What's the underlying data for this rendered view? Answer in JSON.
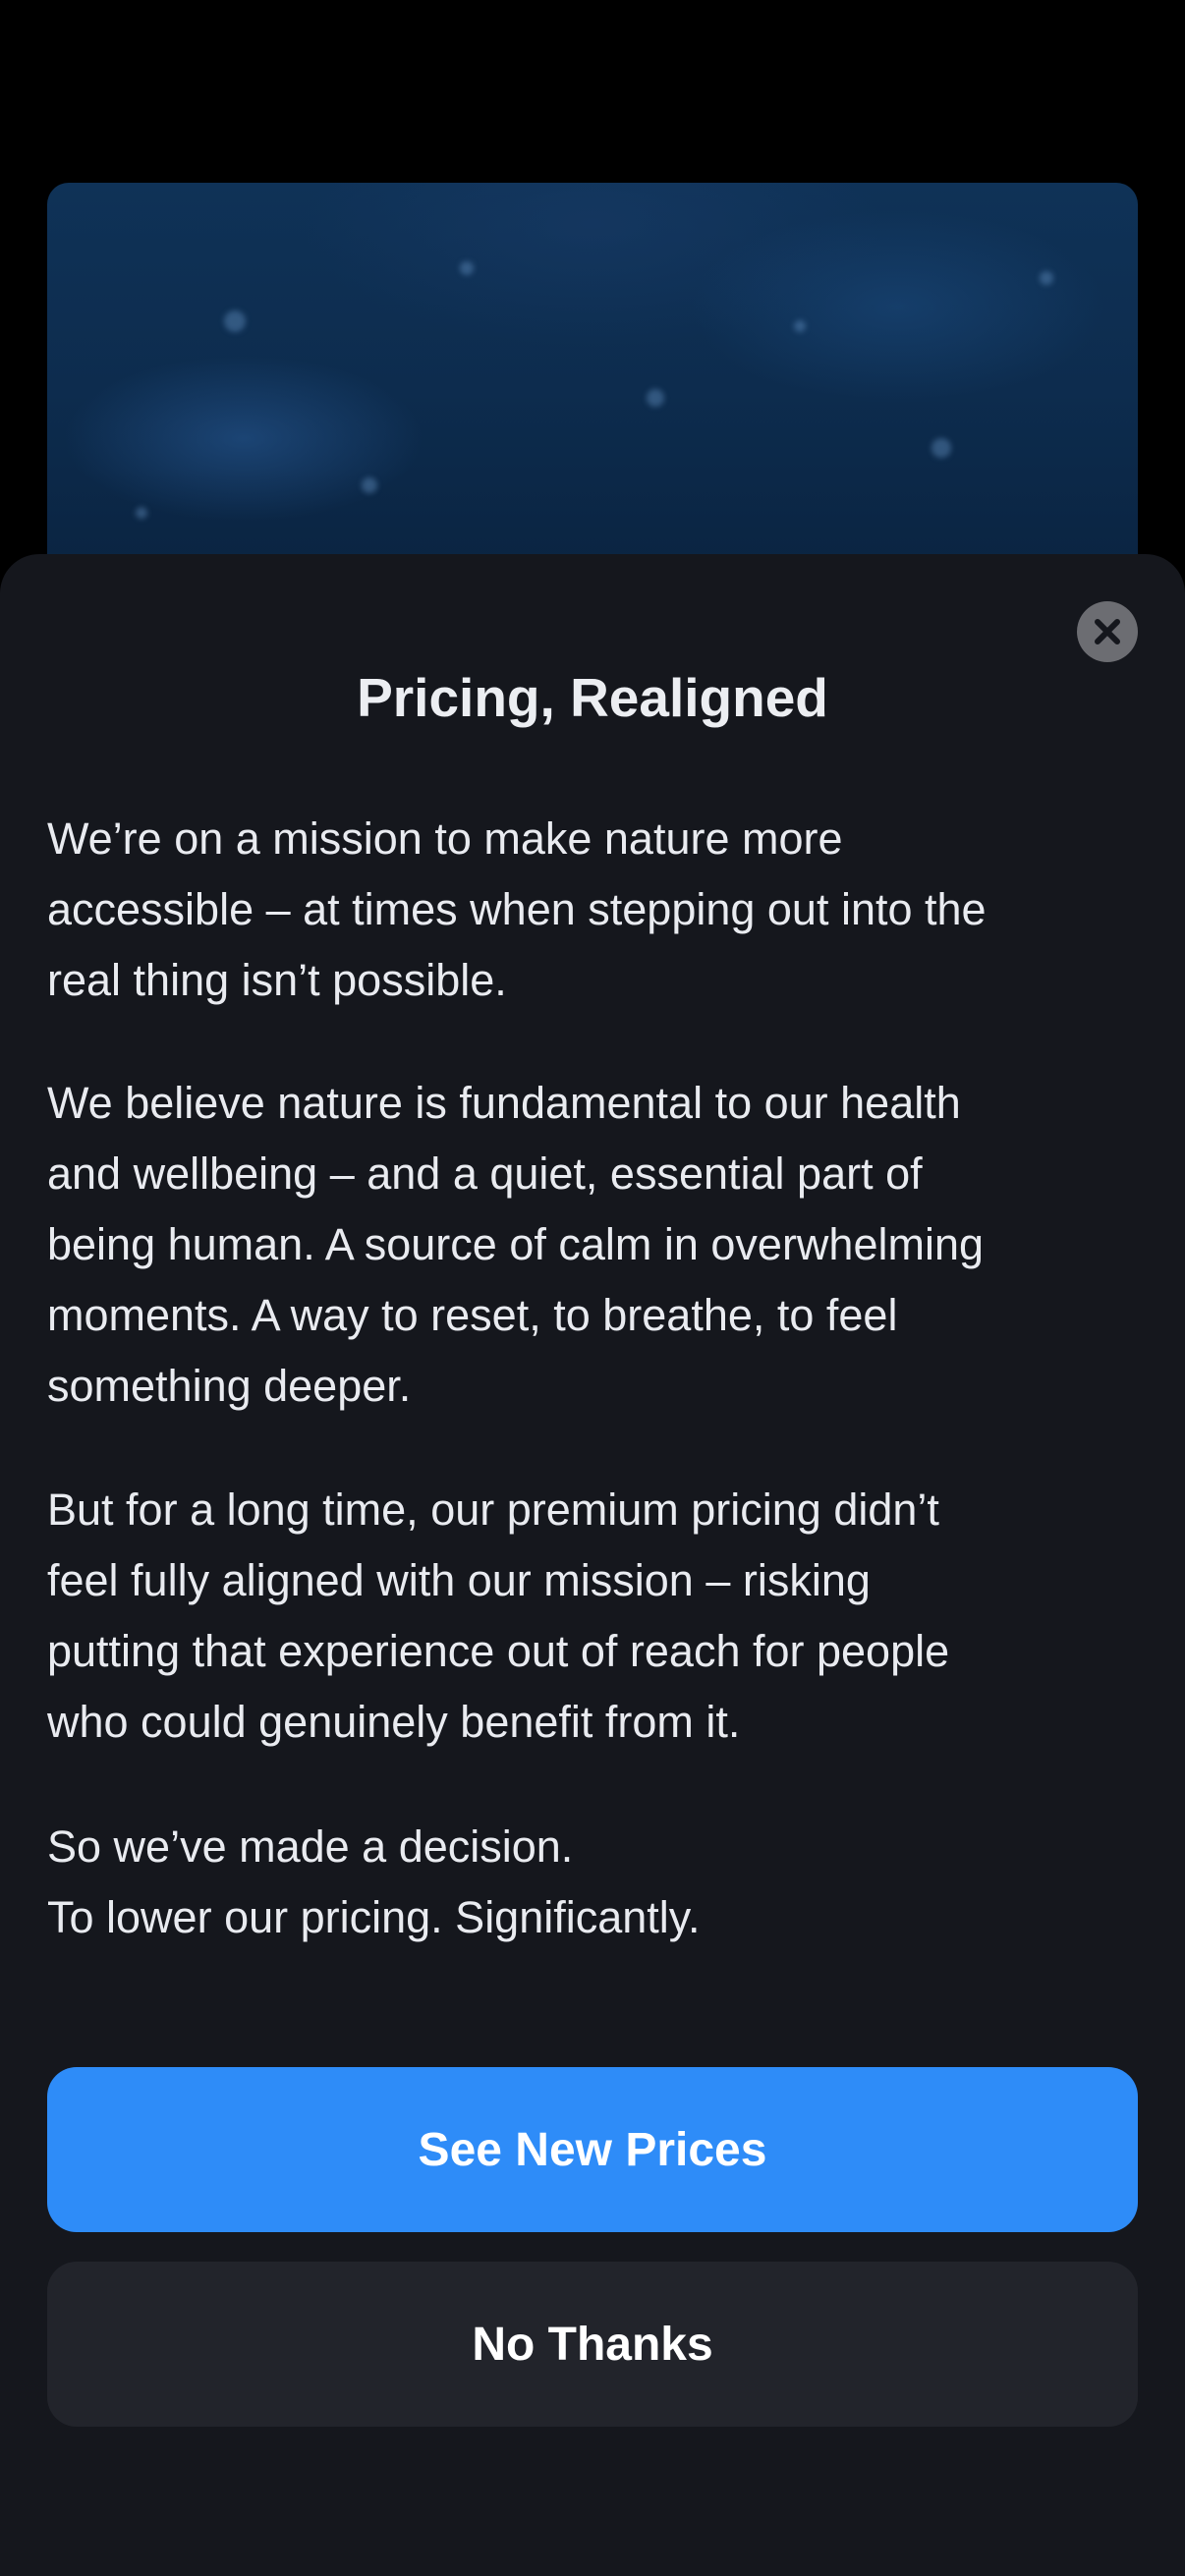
{
  "modal": {
    "title": "Pricing, Realigned",
    "paragraphs": [
      [
        "We’re on a mission to make nature more",
        "accessible – at times when stepping out into the",
        "real thing isn’t possible."
      ],
      [
        "We believe nature is fundamental to our health",
        "and wellbeing – and a quiet, essential part of",
        "being human. A source of calm in overwhelming",
        "moments. A way to reset, to breathe, to feel",
        "something deeper."
      ],
      [
        "But for a long time, our premium pricing didn’t",
        "feel fully aligned with our mission – risking",
        "putting that experience out of reach for people",
        "who could genuinely benefit from it."
      ],
      [
        "So we’ve made a decision.",
        "To lower our pricing. Significantly."
      ]
    ],
    "primary_button_label": "See New Prices",
    "secondary_button_label": "No Thanks",
    "close_icon": "close-icon"
  },
  "colors": {
    "page_background": "#000000",
    "sheet_background": "#15171d",
    "primary_button": "#2e8cf8",
    "secondary_button": "#22242b",
    "close_button": "#6c6d72",
    "hero_blue": "#0f3257"
  }
}
